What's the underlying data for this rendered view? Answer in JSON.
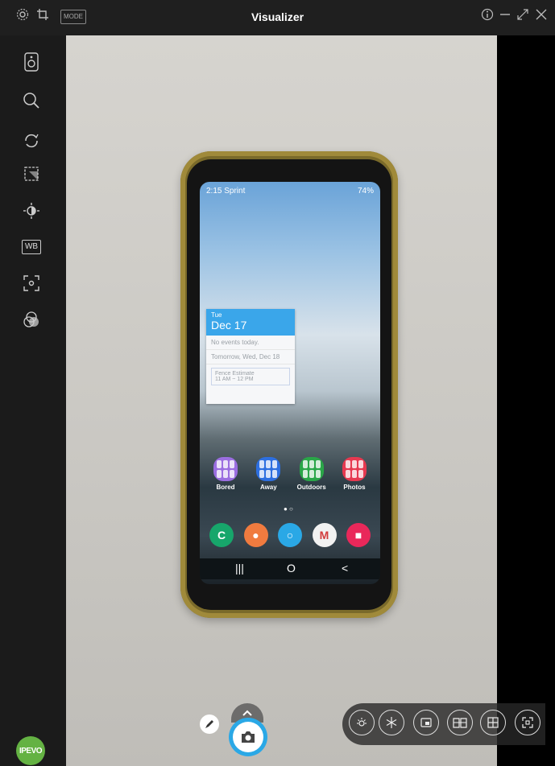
{
  "titlebar": {
    "title": "Visualizer",
    "mode_label": "MODE",
    "icons": [
      "gear-icon",
      "crop-icon",
      "info-icon",
      "minimize-icon",
      "expand-icon",
      "close-icon"
    ]
  },
  "sidebar": {
    "items": [
      {
        "name": "camera-device-icon"
      },
      {
        "name": "zoom-icon"
      },
      {
        "name": "rotate-icon"
      },
      {
        "name": "crop-frame-icon"
      },
      {
        "name": "brightness-icon"
      },
      {
        "name": "white-balance",
        "label": "WB"
      },
      {
        "name": "focus-icon"
      },
      {
        "name": "color-filter-icon"
      }
    ]
  },
  "phone": {
    "status": {
      "time": "2:15",
      "carrier": "Sprint",
      "battery": "74%"
    },
    "widget": {
      "day": "Tue",
      "date": "Dec 17",
      "line1": "No events today.",
      "line2": "Tomorrow, Wed, Dec 18",
      "event_title": "Fence Estimate",
      "event_time": "11 AM ~ 12 PM"
    },
    "apps": [
      {
        "label": "Bored",
        "color": "#9b6ee0"
      },
      {
        "label": "Away",
        "color": "#2d6fe0"
      },
      {
        "label": "Outdoors",
        "color": "#2aa648"
      },
      {
        "label": "Photos",
        "color": "#e63950"
      }
    ],
    "dock": [
      {
        "glyph": "C",
        "color": "#17a66b"
      },
      {
        "glyph": "●",
        "color": "#f07b3f"
      },
      {
        "glyph": "○",
        "color": "#2aa8e6"
      },
      {
        "glyph": "M",
        "color": "#f2f2f2"
      },
      {
        "glyph": "■",
        "color": "#e9285a"
      }
    ],
    "nav": [
      "|||",
      "O",
      "<"
    ]
  },
  "bottom": {
    "brand": "IPEVO",
    "tools": [
      "brightness-tool-icon",
      "freeze-icon",
      "picture-in-picture-icon",
      "book-icon",
      "split-view-icon",
      "capture-region-icon"
    ]
  },
  "colors": {
    "accent": "#2aa8e6",
    "brand": "#64b243"
  }
}
